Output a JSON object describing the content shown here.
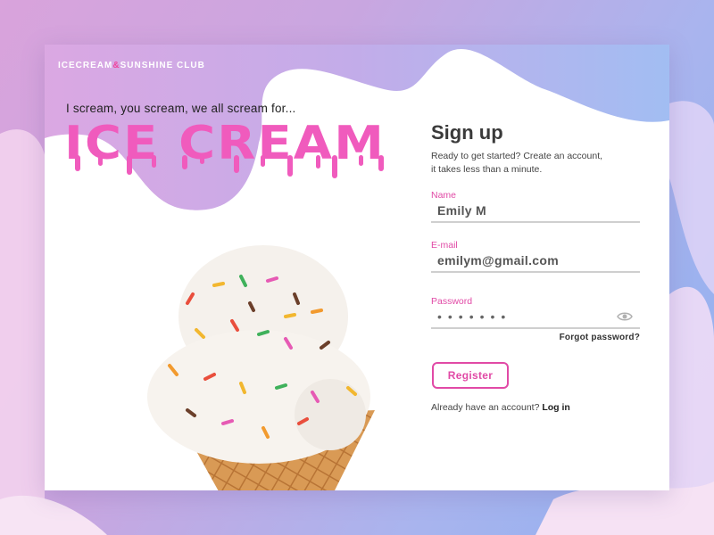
{
  "brand": {
    "part1": "ICECREAM",
    "amp": "&",
    "part2": "SUNSHINE CLUB"
  },
  "hero": {
    "tagline": "I scream, you scream, we all scream for...",
    "title": "ICE CREAM",
    "image": "ice-cream-cone-with-sprinkles"
  },
  "form": {
    "title": "Sign up",
    "subtitle": "Ready to get started? Create an account, it takes less than a minute.",
    "name_label": "Name",
    "name_value": "Emily M",
    "email_label": "E-mail",
    "email_value": "emilym@gmail.com",
    "password_label": "Password",
    "password_mask": "•••••••",
    "password_icon": "eye-icon",
    "forgot_label": "Forgot password?",
    "register_label": "Register",
    "login_prompt": "Already have an account?",
    "login_link": "Log in"
  },
  "colors": {
    "accent": "#e14aa6",
    "title_pink": "#f05bbd",
    "card": "#ffffff"
  }
}
